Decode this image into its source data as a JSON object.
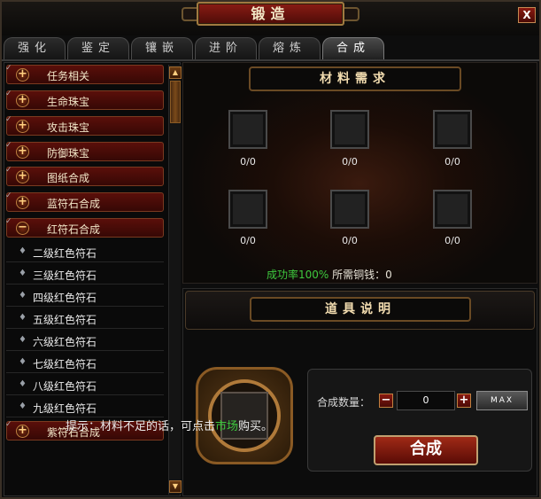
{
  "window": {
    "title": "锻造",
    "close_label": "X"
  },
  "tabs": [
    {
      "label": "强化"
    },
    {
      "label": "鉴定"
    },
    {
      "label": "镶嵌"
    },
    {
      "label": "进阶"
    },
    {
      "label": "熔炼"
    },
    {
      "label": "合成",
      "active": true
    }
  ],
  "list": {
    "cats_top": [
      {
        "label": "任务相关",
        "sign": "+"
      },
      {
        "label": "生命珠宝",
        "sign": "+"
      },
      {
        "label": "攻击珠宝",
        "sign": "+"
      },
      {
        "label": "防御珠宝",
        "sign": "+"
      },
      {
        "label": "图纸合成",
        "sign": "+"
      },
      {
        "label": "蓝符石合成",
        "sign": "+"
      },
      {
        "label": "红符石合成",
        "sign": "−"
      }
    ],
    "subs": [
      "二级红色符石",
      "三级红色符石",
      "四级红色符石",
      "五级红色符石",
      "六级红色符石",
      "七级红色符石",
      "八级红色符石",
      "九级红色符石"
    ],
    "cat_bottom": {
      "label": "紫符石合成",
      "sign": "+"
    }
  },
  "materials": {
    "header": "材料需求",
    "counts": [
      "0/0",
      "0/0",
      "0/0",
      "0/0",
      "0/0",
      "0/0"
    ],
    "rate_label": "成功率100%",
    "cost_label": "所需铜钱：0"
  },
  "desc": {
    "header": "道具说明"
  },
  "synth": {
    "qty_label": "合成数量：",
    "qty_value": "0",
    "minus": "−",
    "plus": "+",
    "max_label": "MAX",
    "combine_label": "合成"
  },
  "hint": {
    "prefix": "提示：材料不足的话，可点击",
    "link": "市场",
    "suffix": "购买。"
  }
}
